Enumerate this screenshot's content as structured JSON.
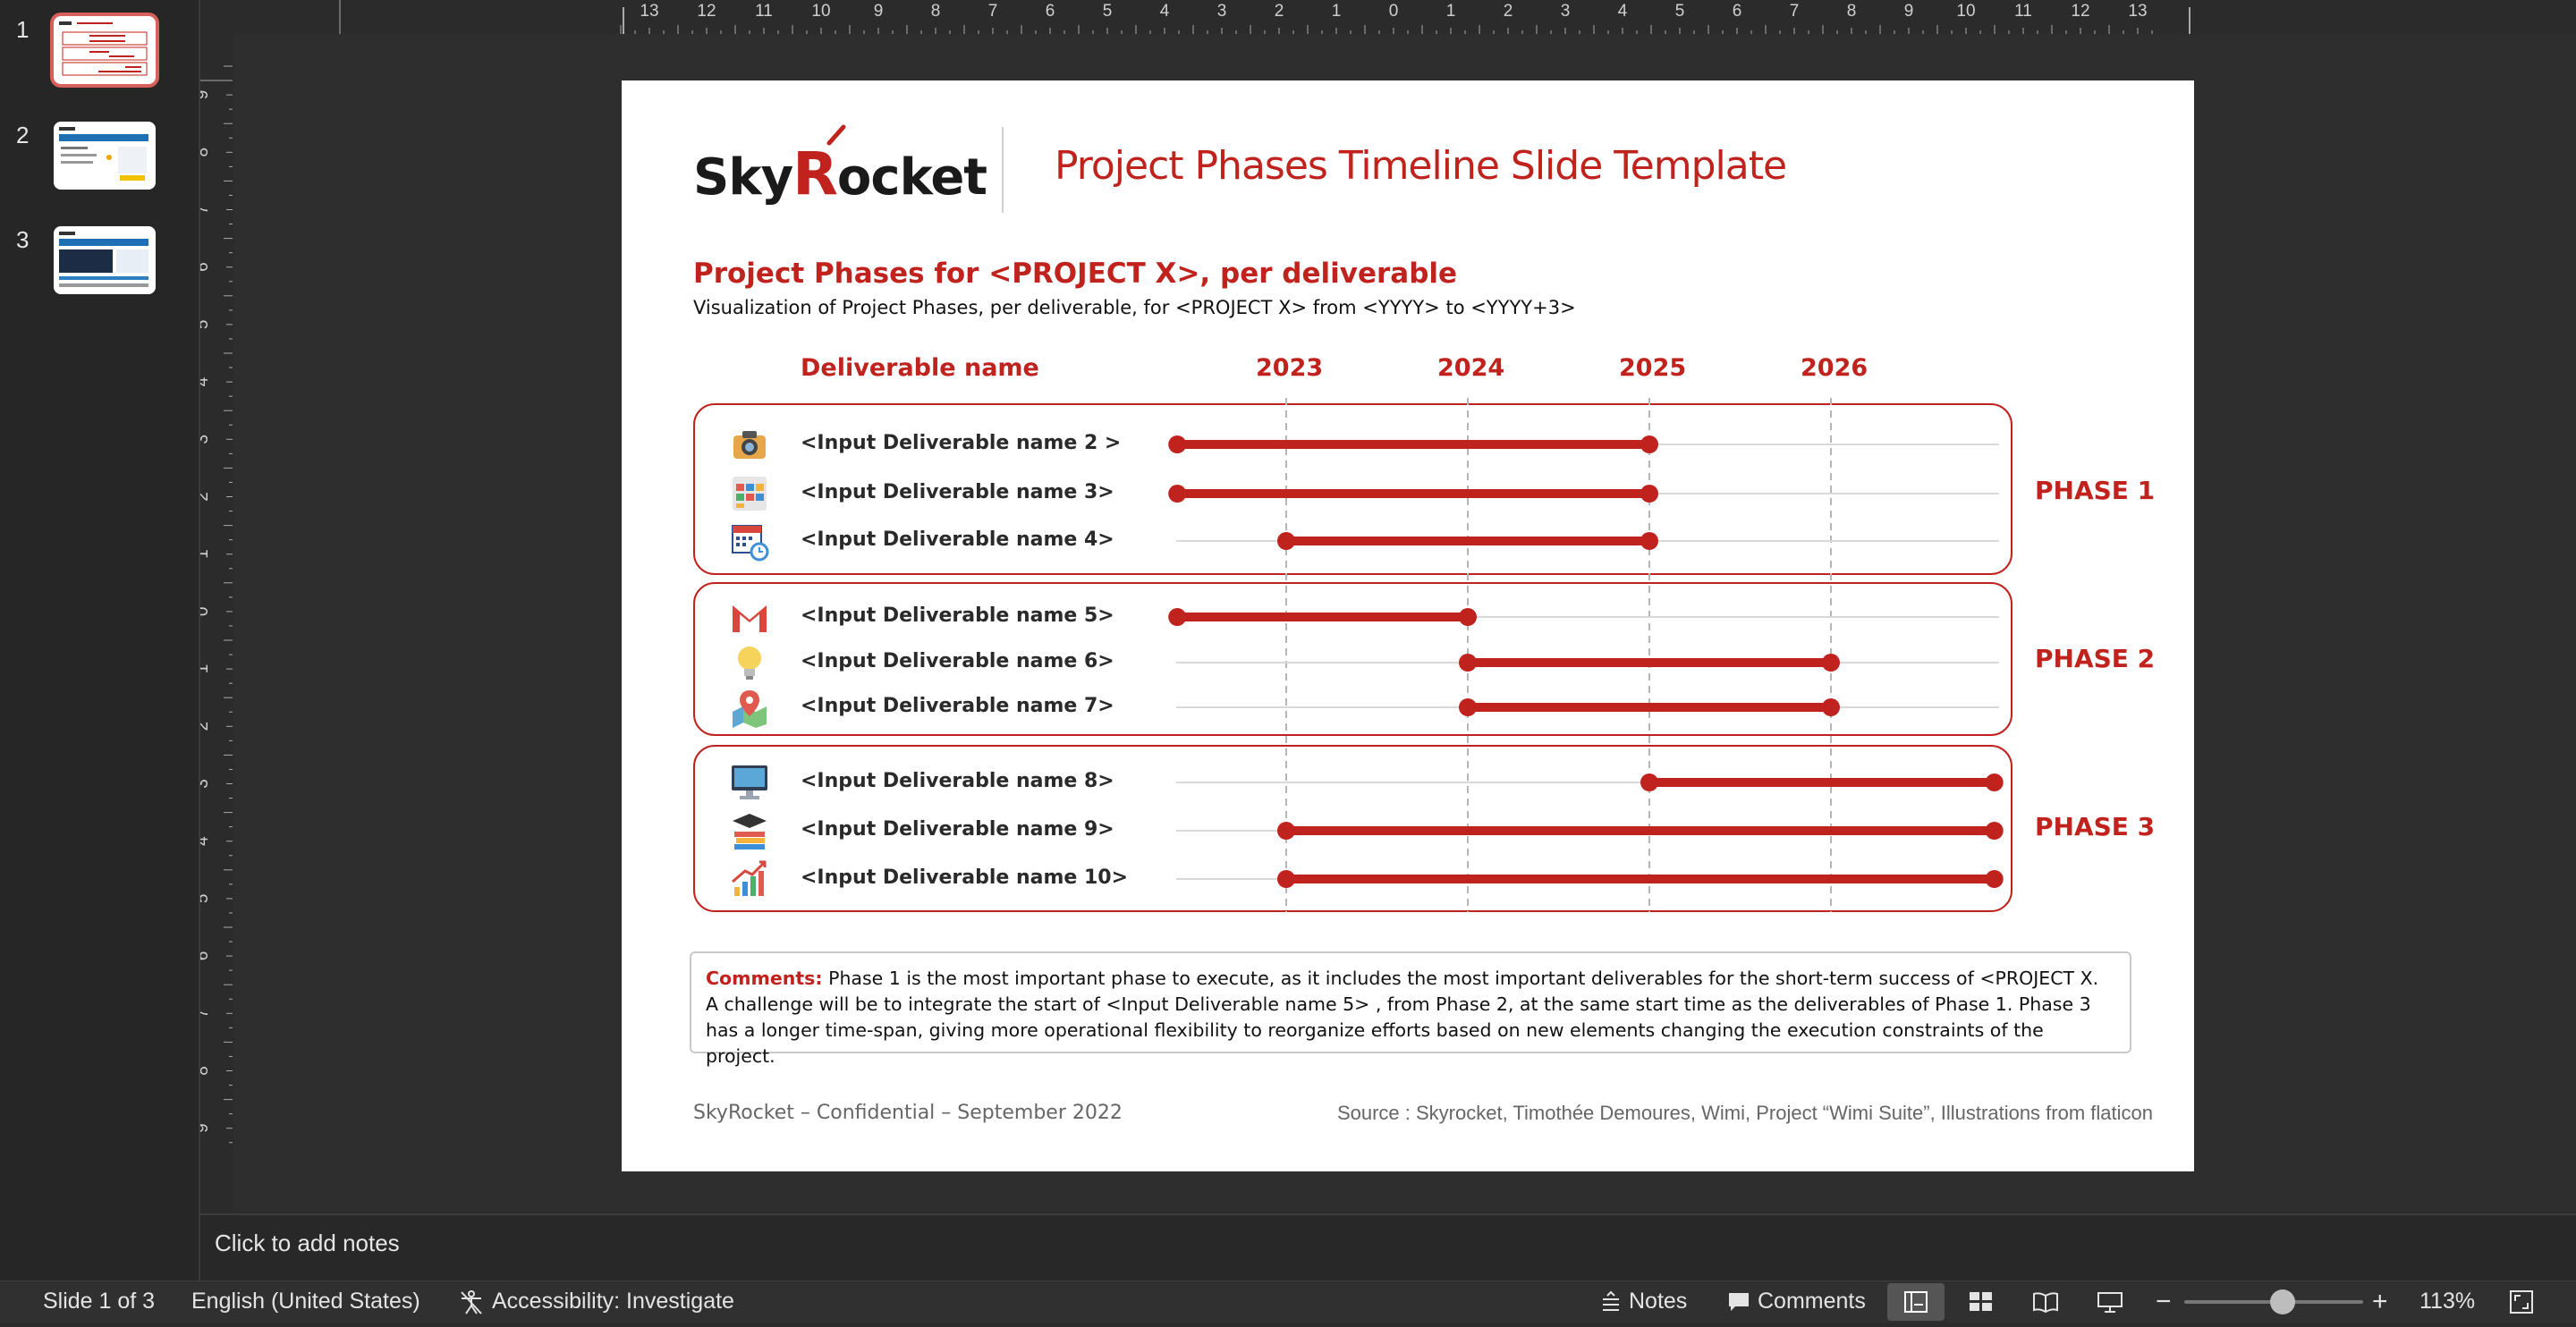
{
  "thumbnails": [
    {
      "num": "1",
      "selected": true
    },
    {
      "num": "2",
      "selected": false
    },
    {
      "num": "3",
      "selected": false
    }
  ],
  "ruler": {
    "h_ticks": [
      "13",
      "12",
      "11",
      "10",
      "9",
      "8",
      "7",
      "6",
      "5",
      "4",
      "3",
      "2",
      "1",
      "0",
      "1",
      "2",
      "3",
      "4",
      "5",
      "6",
      "7",
      "8",
      "9",
      "10",
      "11",
      "12",
      "13"
    ],
    "v_ticks": [
      "9",
      "8",
      "7",
      "6",
      "5",
      "4",
      "3",
      "2",
      "1",
      "0",
      "1",
      "2",
      "3",
      "4",
      "5",
      "6",
      "7",
      "8",
      "9"
    ]
  },
  "slide": {
    "logo_left": "Sky",
    "logo_r": "R",
    "logo_right": "ocket",
    "header_title": "Project Phases Timeline Slide Template",
    "title": "Project Phases for <PROJECT X>, per deliverable",
    "subtitle": "Visualization of Project Phases, per deliverable, for <PROJECT X> from <YYYY> to <YYYY+3>",
    "column_header": "Deliverable name",
    "years": [
      "2023",
      "2024",
      "2025",
      "2026"
    ],
    "rows": [
      {
        "label": "<Input Deliverable name 2 >",
        "icon": "camera-icon",
        "start": 2022.4,
        "end": 2025.0
      },
      {
        "label": "<Input Deliverable name 3>",
        "icon": "app-grid-icon",
        "start": 2022.4,
        "end": 2025.0
      },
      {
        "label": "<Input Deliverable name 4>",
        "icon": "calendar-clock-icon",
        "start": 2023.0,
        "end": 2025.0
      },
      {
        "label": "<Input Deliverable name 5>",
        "icon": "gmail-icon",
        "start": 2022.4,
        "end": 2024.0
      },
      {
        "label": "<Input Deliverable name 6>",
        "icon": "lightbulb-icon",
        "start": 2024.0,
        "end": 2026.0
      },
      {
        "label": "<Input Deliverable name 7>",
        "icon": "map-pin-icon",
        "start": 2024.0,
        "end": 2026.0
      },
      {
        "label": "<Input Deliverable name 8>",
        "icon": "monitor-icon",
        "start": 2025.0,
        "end": 2026.9
      },
      {
        "label": "<Input Deliverable name 9>",
        "icon": "graduation-books-icon",
        "start": 2023.0,
        "end": 2026.9
      },
      {
        "label": "<Input Deliverable name 10>",
        "icon": "growth-chart-icon",
        "start": 2023.0,
        "end": 2026.9
      }
    ],
    "phases": [
      "PHASE 1",
      "PHASE 2",
      "PHASE 3"
    ],
    "comments_label": "Comments:",
    "comments_text": " Phase 1 is the most important phase to execute, as it includes the most important deliverables for the short-term success of <PROJECT X. A challenge will be to integrate the start of <Input Deliverable name 5> , from Phase 2, at the same start time as the deliverables of Phase 1. Phase 3 has a longer time-span, giving more operational flexibility to reorganize efforts based on new elements changing the execution constraints of the project.",
    "footer_left": "SkyRocket – Confidential – September 2022",
    "footer_right": "Source : Skyrocket, Timothée Demoures, Wimi, Project “Wimi Suite”, Illustrations from flaticon"
  },
  "notes_placeholder": "Click to add notes",
  "status": {
    "slide_info": "Slide 1 of 3",
    "language": "English (United States)",
    "accessibility": "Accessibility: Investigate",
    "notes": "Notes",
    "comments": "Comments",
    "zoom": "113%",
    "zoom_level": 0.5
  },
  "colors": {
    "accent": "#c0231d",
    "track": "#d9d9d9"
  }
}
